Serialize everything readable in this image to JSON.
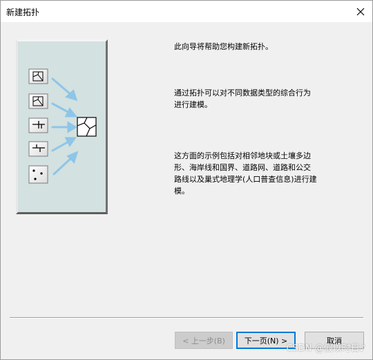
{
  "window": {
    "title": "新建拓扑",
    "close_glyph": "✕"
  },
  "description": {
    "para1": "此向导将帮助您构建新拓扑。",
    "para2": "通过拓扑可以对不同数据类型的综合行为\n进行建模。",
    "para3": "这方面的示例包括对相邻地块或土壤多边\n形、海岸线和国界、道路网、道路和公交\n路线以及巢式地理学(人口普查信息)进行建\n模。"
  },
  "buttons": {
    "back": "< 上一步(B)",
    "next": "下一页(N) >",
    "cancel": "取消"
  },
  "watermark": "CSDN @假以时日♪",
  "illustration_icons": [
    "parcel-polygon-icon",
    "parcel-polygon-icon",
    "line-node-icon",
    "line-node-icon",
    "points-icon",
    "topology-result-icon"
  ],
  "colors": {
    "illustration_bg": "#d3e1e0",
    "arrow": "#8ec5e8",
    "default_button_border": "#0078d7"
  }
}
